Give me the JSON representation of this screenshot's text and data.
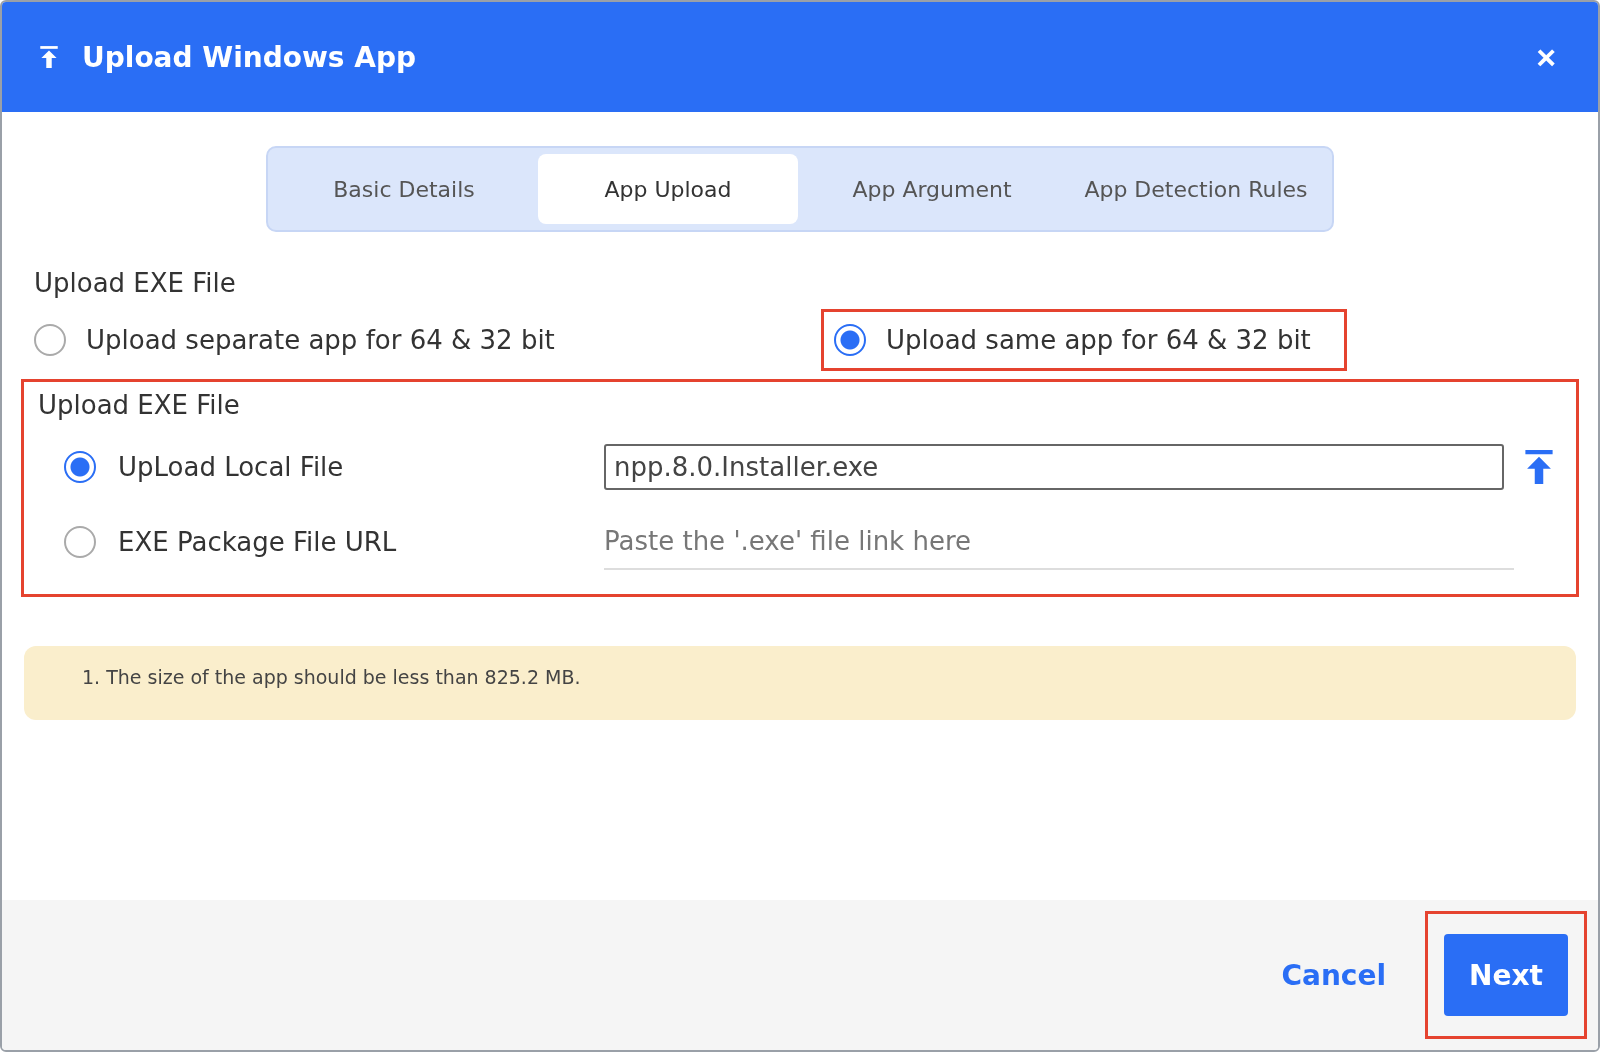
{
  "dialog": {
    "title": "Upload Windows App",
    "close": "×"
  },
  "tabs": [
    {
      "label": "Basic Details",
      "selected": false
    },
    {
      "label": "App Upload",
      "selected": true
    },
    {
      "label": "App Argument",
      "selected": false
    },
    {
      "label": "App Detection Rules",
      "selected": false
    }
  ],
  "upload_mode": {
    "heading": "Upload EXE File",
    "options": [
      {
        "label": "Upload separate app for 64 & 32 bit",
        "selected": false,
        "highlighted": false
      },
      {
        "label": "Upload same app for 64 & 32 bit",
        "selected": true,
        "highlighted": true
      }
    ]
  },
  "source": {
    "heading": "Upload EXE File",
    "highlighted": true,
    "options": [
      {
        "kind": "file",
        "label": "UpLoad Local File",
        "selected": true,
        "value": "npp.8.0.Installer.exe"
      },
      {
        "kind": "url",
        "label": "EXE Package File URL",
        "selected": false,
        "placeholder": "Paste the '.exe' file link here"
      }
    ]
  },
  "note": "1. The size of the app should be less than 825.2 MB.",
  "footer": {
    "cancel": "Cancel",
    "next": "Next",
    "next_highlighted": true
  }
}
